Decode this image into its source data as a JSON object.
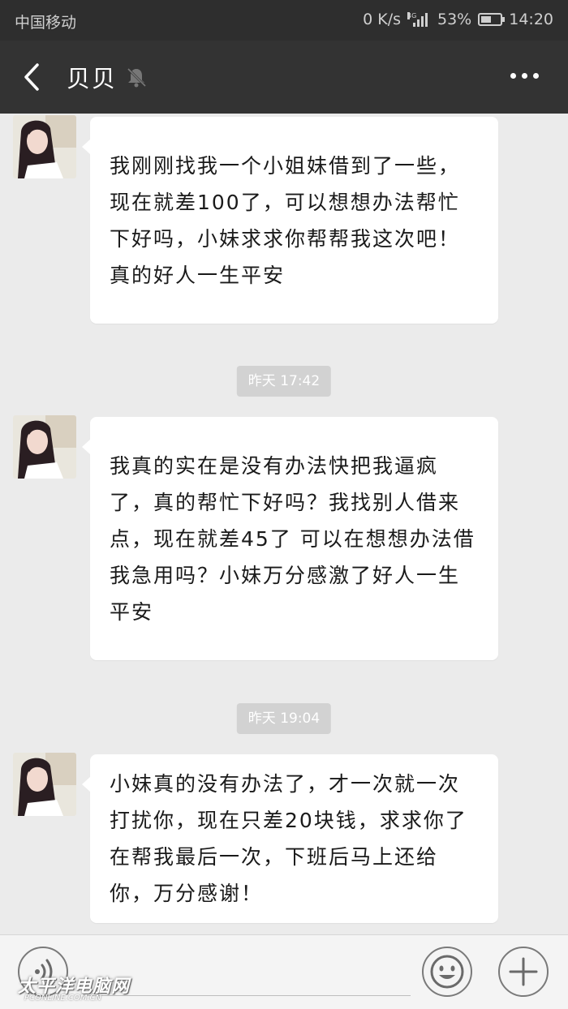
{
  "status_bar": {
    "carrier": "中国移动",
    "network_speed": "0 K/s",
    "network_type": "4G",
    "battery": "53%",
    "battery_level": 0.53,
    "time": "14:20"
  },
  "header": {
    "title": "贝贝",
    "back_icon": "chevron-left-icon",
    "mute_icon": "bell-off-icon",
    "more_icon": "more-dots-icon"
  },
  "messages": [
    {
      "type": "received",
      "text": "我刚刚找我一个小姐妹借到了一些，现在就差100了，可以想想办法帮忙下好吗，小妹求求你帮帮我这次吧！真的好人一生平安"
    },
    {
      "type": "timestamp",
      "text": "昨天 17:42"
    },
    {
      "type": "received",
      "text": "我真的实在是没有办法快把我逼疯了，真的帮忙下好吗？我找别人借来点，现在就差45了 可以在想想办法借我急用吗？小妹万分感激了好人一生平安"
    },
    {
      "type": "timestamp",
      "text": "昨天 19:04"
    },
    {
      "type": "received",
      "text": "小妹真的没有办法了，才一次就一次打扰你，现在只差20块钱，求求你了在帮我最后一次，下班后马上还给你，万分感谢！"
    }
  ],
  "input_bar": {
    "voice_icon": "voice-icon",
    "emoji_icon": "emoji-icon",
    "plus_icon": "plus-icon"
  },
  "watermark": {
    "text": "太平洋电脑网",
    "sub": "PCONLINE.COM.CN"
  },
  "colors": {
    "header_bg": "#333333",
    "status_bg": "#2e2e2e",
    "chat_bg": "#ebebeb",
    "bubble_bg": "#ffffff",
    "timestamp_bg": "#d2d2d2"
  }
}
